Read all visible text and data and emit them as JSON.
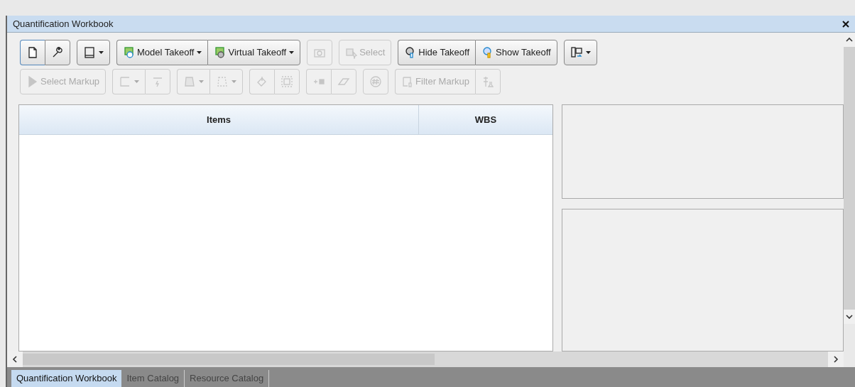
{
  "window": {
    "title": "Quantification Workbook"
  },
  "toolbar": {
    "rows": [
      [
        {
          "buttons": [
            {
              "selected": true,
              "disabled": false,
              "dropdown": false
            },
            {
              "selected": false,
              "disabled": false,
              "dropdown": false
            }
          ]
        },
        {
          "buttons": [
            {
              "selected": false,
              "disabled": false,
              "dropdown": true
            }
          ]
        },
        {
          "buttons": [
            {
              "label": "Model Takeoff",
              "selected": false,
              "disabled": false,
              "dropdown": true
            },
            {
              "label": "Virtual Takeoff",
              "selected": false,
              "disabled": false,
              "dropdown": true
            }
          ]
        },
        {
          "buttons": [
            {
              "selected": false,
              "disabled": true,
              "dropdown": false
            }
          ]
        },
        {
          "buttons": [
            {
              "label": "Select",
              "selected": false,
              "disabled": true,
              "dropdown": false
            }
          ]
        },
        {
          "buttons": [
            {
              "label": "Hide Takeoff",
              "selected": false,
              "disabled": false,
              "dropdown": false
            },
            {
              "label": "Show Takeoff",
              "selected": false,
              "disabled": false,
              "dropdown": false
            }
          ]
        },
        {
          "buttons": [
            {
              "selected": false,
              "disabled": false,
              "dropdown": true
            }
          ]
        }
      ],
      [
        {
          "buttons": [
            {
              "label": "Select Markup",
              "selected": false,
              "disabled": true,
              "dropdown": false
            }
          ]
        },
        {
          "buttons": [
            {
              "selected": false,
              "disabled": true,
              "dropdown": true
            },
            {
              "selected": false,
              "disabled": true,
              "dropdown": false
            }
          ]
        },
        {
          "buttons": [
            {
              "selected": false,
              "disabled": true,
              "dropdown": true
            },
            {
              "selected": false,
              "disabled": true,
              "dropdown": true
            }
          ]
        },
        {
          "buttons": [
            {
              "selected": false,
              "disabled": true,
              "dropdown": false
            },
            {
              "selected": false,
              "disabled": true,
              "dropdown": false
            }
          ]
        },
        {
          "buttons": [
            {
              "selected": false,
              "disabled": true,
              "dropdown": false
            },
            {
              "selected": false,
              "disabled": true,
              "dropdown": false
            }
          ]
        },
        {
          "buttons": [
            {
              "selected": false,
              "disabled": true,
              "dropdown": false
            }
          ]
        },
        {
          "buttons": [
            {
              "label": "Filter Markup",
              "selected": false,
              "disabled": true,
              "dropdown": false
            },
            {
              "selected": false,
              "disabled": true,
              "dropdown": false
            }
          ]
        }
      ]
    ]
  },
  "table": {
    "columns": [
      "Items",
      "WBS"
    ]
  },
  "tabs": [
    {
      "label": "Quantification Workbook",
      "selected": true
    },
    {
      "label": "Item Catalog",
      "selected": false
    },
    {
      "label": "Resource Catalog",
      "selected": false
    }
  ]
}
